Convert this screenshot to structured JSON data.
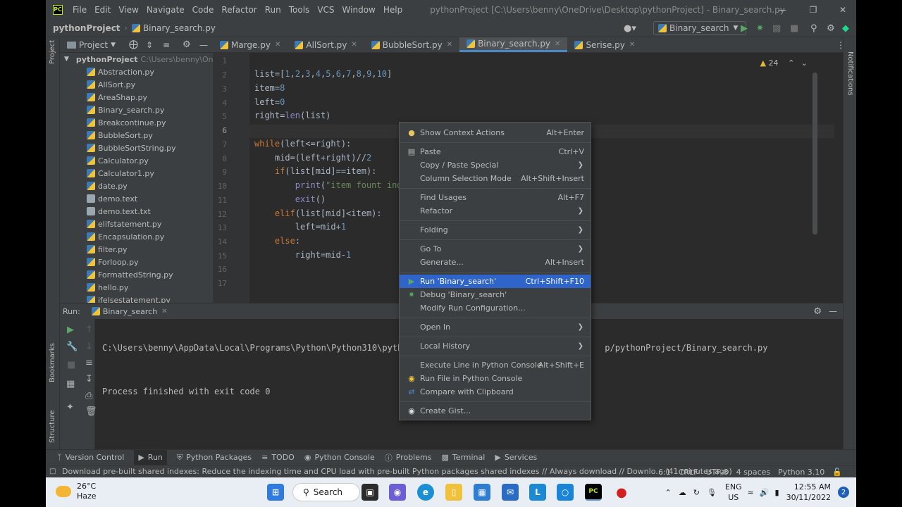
{
  "window": {
    "menu": [
      "File",
      "Edit",
      "View",
      "Navigate",
      "Code",
      "Refactor",
      "Run",
      "Tools",
      "VCS",
      "Window",
      "Help"
    ],
    "title": "pythonProject [C:\\Users\\benny\\OneDrive\\Desktop\\pythonProject] - Binary_search.py",
    "logo": "PC"
  },
  "navbar": {
    "project": "pythonProject",
    "file": "Binary_search.py",
    "run_config": "Binary_search"
  },
  "project_panel": {
    "title": "Project",
    "root_name": "pythonProject",
    "root_path": "C:\\Users\\benny\\OneDrive",
    "files": [
      "Abstraction.py",
      "AllSort.py",
      "AreaShap.py",
      "Binary_search.py",
      "Breakcontinue.py",
      "BubbleSort.py",
      "BubbleSortString.py",
      "Calculator.py",
      "Calculator1.py",
      "date.py",
      "demo.text",
      "demo.text.txt",
      "elifstatement.py",
      "Encapsulation.py",
      "filter.py",
      "Forloop.py",
      "FormattedString.py",
      "hello.py",
      "ifelsestatement.py"
    ]
  },
  "side_stripe": {
    "project": "Project",
    "bookmarks": "Bookmarks",
    "structure": "Structure",
    "notifications": "Notifications"
  },
  "tabs": [
    "Marge.py",
    "AllSort.py",
    "BubbleSort.py",
    "Binary_search.py",
    "Serise.py"
  ],
  "active_tab_index": 3,
  "editor": {
    "warning_count": "24",
    "line_numbers": [
      "1",
      "2",
      "3",
      "4",
      "5",
      "6",
      "7",
      "8",
      "9",
      "10",
      "11",
      "12",
      "13",
      "14",
      "15",
      "16",
      "17"
    ]
  },
  "run_panel": {
    "label": "Run:",
    "tab": "Binary_search",
    "output_path_start": "C:\\Users\\benny\\AppData\\Local\\Programs\\Python\\Python310\\pyth",
    "output_path_end": "p/pythonProject/Binary_search.py",
    "output_exit": "Process finished with exit code 0"
  },
  "context_menu": {
    "items": [
      {
        "label": "Show Context Actions",
        "shortcut": "Alt+Enter",
        "icon": "lightbulb-icon"
      },
      {
        "label": "Paste",
        "shortcut": "Ctrl+V",
        "icon": "clipboard-icon"
      },
      {
        "label": "Copy / Paste Special",
        "submenu": true
      },
      {
        "label": "Column Selection Mode",
        "shortcut": "Alt+Shift+Insert"
      },
      {
        "label": "Find Usages",
        "shortcut": "Alt+F7"
      },
      {
        "label": "Refactor",
        "submenu": true
      },
      {
        "label": "Folding",
        "submenu": true
      },
      {
        "label": "Go To",
        "submenu": true
      },
      {
        "label": "Generate...",
        "shortcut": "Alt+Insert"
      },
      {
        "label": "Run 'Binary_search'",
        "shortcut": "Ctrl+Shift+F10",
        "icon": "run-icon",
        "selected": true
      },
      {
        "label": "Debug 'Binary_search'",
        "icon": "debug-icon"
      },
      {
        "label": "Modify Run Configuration..."
      },
      {
        "label": "Open In",
        "submenu": true
      },
      {
        "label": "Local History",
        "submenu": true
      },
      {
        "label": "Execute Line in Python Console",
        "shortcut": "Alt+Shift+E"
      },
      {
        "label": "Run File in Python Console",
        "icon": "python-icon"
      },
      {
        "label": "Compare with Clipboard",
        "icon": "compare-icon"
      },
      {
        "label": "Create Gist...",
        "icon": "github-icon"
      }
    ]
  },
  "tool_windows": [
    "Version Control",
    "Run",
    "Python Packages",
    "TODO",
    "Python Console",
    "Problems",
    "Terminal",
    "Services"
  ],
  "status": {
    "message": "Download pre-built shared indexes: Reduce the indexing time and CPU load with pre-built Python packages shared indexes // Always download // Downlo... (41 minutes ago)",
    "position": "6:1",
    "line_sep": "CRLF",
    "encoding": "UTF-8",
    "indent": "4 spaces",
    "interpreter": "Python 3.10"
  },
  "taskbar": {
    "temp": "26°C",
    "weather": "Haze",
    "search": "Search",
    "lang1": "ENG",
    "lang2": "US",
    "time": "12:55 AM",
    "date": "30/11/2022",
    "notifications": "2"
  }
}
